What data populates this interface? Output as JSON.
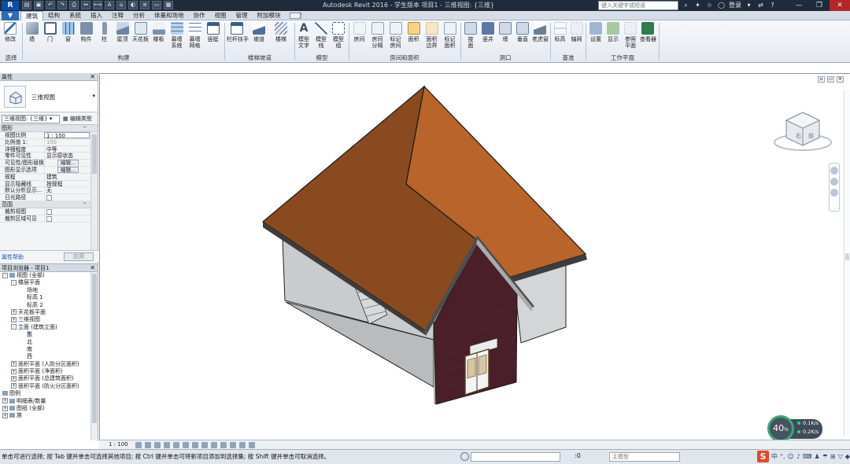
{
  "titlebar": {
    "app_title": "Autodesk Revit 2016 -  学生版本     项目1 - 三维视图: {三维}",
    "search_placeholder": "键入关键字或短语",
    "login_label": "登录",
    "help_icon": "?",
    "window_buttons": [
      "—",
      "❐",
      "✕"
    ]
  },
  "app_menu_label": "R",
  "tabs": [
    "建筑",
    "结构",
    "系统",
    "插入",
    "注释",
    "分析",
    "体量和场地",
    "协作",
    "视图",
    "管理",
    "附加模块",
    "修改"
  ],
  "active_tab": "建筑",
  "ribbon": {
    "select": {
      "button": "修改",
      "group": "选择"
    },
    "build": {
      "buttons": [
        "墙",
        "门",
        "窗",
        "构件",
        "柱",
        "屋顶",
        "天花板",
        "楼板",
        "幕墙\n系统",
        "幕墙\n网格",
        "竖梃"
      ],
      "group": "构建"
    },
    "circulation": {
      "buttons": [
        "栏杆扶手",
        "坡道",
        "楼梯"
      ],
      "group": "楼梯坡道"
    },
    "model": {
      "buttons": [
        "模型\n文字",
        "模型\n线",
        "模型\n组"
      ],
      "group": "模型"
    },
    "room_area": {
      "buttons": [
        "房间",
        "房间\n分隔",
        "标记\n房间",
        "面积",
        "面积\n边界",
        "标记\n面积"
      ],
      "group": "房间和面积"
    },
    "opening": {
      "buttons": [
        "按\n面",
        "竖井",
        "墙",
        "垂直",
        "老虎窗"
      ],
      "group": "洞口"
    },
    "datum": {
      "buttons": [
        "标高",
        "轴网"
      ],
      "group": "基准"
    },
    "workplane": {
      "buttons": [
        "设置",
        "显示",
        "参照\n平面",
        "查看器"
      ],
      "group": "工作平面"
    }
  },
  "properties": {
    "title": "属性",
    "type_name": "三维视图",
    "view_selector": "三维视图: {三维}",
    "edit_type": "编辑类型",
    "sections": [
      {
        "name": "图形",
        "rows": [
          {
            "k": "视图比例",
            "v": "1 : 100"
          },
          {
            "k": "比例值 1:",
            "v": "100"
          },
          {
            "k": "详细程度",
            "v": "中等"
          },
          {
            "k": "零件可见性",
            "v": "显示原状态"
          },
          {
            "k": "可见性/图形替换",
            "v": "编辑..."
          },
          {
            "k": "图形显示选项",
            "v": "编辑..."
          },
          {
            "k": "规程",
            "v": "建筑"
          },
          {
            "k": "显示隐藏线",
            "v": "按规程"
          },
          {
            "k": "默认分析显示...",
            "v": "无"
          },
          {
            "k": "日光路径",
            "v": ""
          }
        ]
      },
      {
        "name": "范围",
        "rows": [
          {
            "k": "裁剪视图",
            "v": ""
          },
          {
            "k": "裁剪区域可见",
            "v": ""
          }
        ]
      }
    ],
    "help": "属性帮助",
    "apply": "应用"
  },
  "browser": {
    "title": "项目浏览器 - 项目1",
    "tree": [
      {
        "level": 0,
        "toggle": "-",
        "label": "视图 (全部)"
      },
      {
        "level": 1,
        "toggle": "-",
        "label": "楼层平面"
      },
      {
        "level": 2,
        "toggle": "",
        "label": "场地"
      },
      {
        "level": 2,
        "toggle": "",
        "label": "标高 1"
      },
      {
        "level": 2,
        "toggle": "",
        "label": "标高 2"
      },
      {
        "level": 1,
        "toggle": "+",
        "label": "天花板平面"
      },
      {
        "level": 1,
        "toggle": "+",
        "label": "三维视图"
      },
      {
        "level": 1,
        "toggle": "-",
        "label": "立面 (建筑立面)"
      },
      {
        "level": 2,
        "toggle": "",
        "label": "东",
        "selected": true
      },
      {
        "level": 2,
        "toggle": "",
        "label": "北"
      },
      {
        "level": 2,
        "toggle": "",
        "label": "南"
      },
      {
        "level": 2,
        "toggle": "",
        "label": "西"
      },
      {
        "level": 1,
        "toggle": "+",
        "label": "面积平面 (人防分区面积)"
      },
      {
        "level": 1,
        "toggle": "+",
        "label": "面积平面 (净面积)"
      },
      {
        "level": 1,
        "toggle": "+",
        "label": "面积平面 (总建筑面积)"
      },
      {
        "level": 1,
        "toggle": "+",
        "label": "面积平面 (防火分区面积)"
      },
      {
        "level": 0,
        "toggle": "",
        "label": "图例"
      },
      {
        "level": 0,
        "toggle": "+",
        "label": "明细表/数量"
      },
      {
        "level": 0,
        "toggle": "+",
        "label": "图纸 (全部)"
      },
      {
        "level": 0,
        "toggle": "+",
        "label": "族"
      }
    ]
  },
  "viewbar": {
    "scale": "1 : 100"
  },
  "network_widget": {
    "percent": "40",
    "percent_unit": "%",
    "up": "0.1K/s",
    "down": "0.2K/s"
  },
  "statusbar": {
    "message": "单击可进行选择; 按 Tab 键并单击可选择其他项目; 按 Ctrl 键并单击可将新项目添加到选择集; 按 Shift 键并单击可取消选择。",
    "zero": ":0",
    "model": "主模型"
  },
  "tray": {
    "s_logo": "S",
    "ime": "中"
  },
  "colors": {
    "roof": "#8a4a1f",
    "roof_lit": "#b8642a",
    "brick": "#4a1f2a",
    "wall_grey": "#c9cbcd",
    "accent_blue": "#2d6db5"
  }
}
